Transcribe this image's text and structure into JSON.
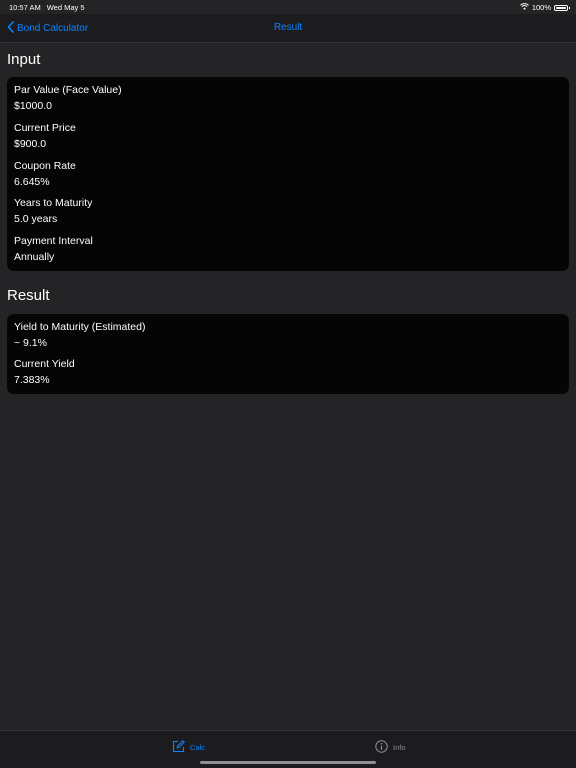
{
  "status_bar": {
    "time": "10:57 AM",
    "date": "Wed May 5",
    "battery": "100%"
  },
  "nav": {
    "back_label": "Bond Calculator",
    "title": "Result"
  },
  "input_section": {
    "title": "Input",
    "fields": [
      {
        "label": "Par Value (Face Value)",
        "value": "$1000.0"
      },
      {
        "label": "Current Price",
        "value": "$900.0"
      },
      {
        "label": "Coupon Rate",
        "value": "6.645%"
      },
      {
        "label": "Years to Maturity",
        "value": "5.0 years"
      },
      {
        "label": "Payment Interval",
        "value": "Annually"
      }
    ]
  },
  "result_section": {
    "title": "Result",
    "fields": [
      {
        "label": "Yield to Maturity (Estimated)",
        "value": "~ 9.1%"
      },
      {
        "label": "Current Yield",
        "value": "7.383%"
      }
    ]
  },
  "tabs": [
    {
      "label": "Calc",
      "icon": "edit-icon",
      "active": true
    },
    {
      "label": "Info",
      "icon": "info-icon",
      "active": false
    }
  ],
  "colors": {
    "accent": "#0a84ff",
    "background": "#242426",
    "card": "#050505",
    "inactive": "#8e8e93"
  }
}
